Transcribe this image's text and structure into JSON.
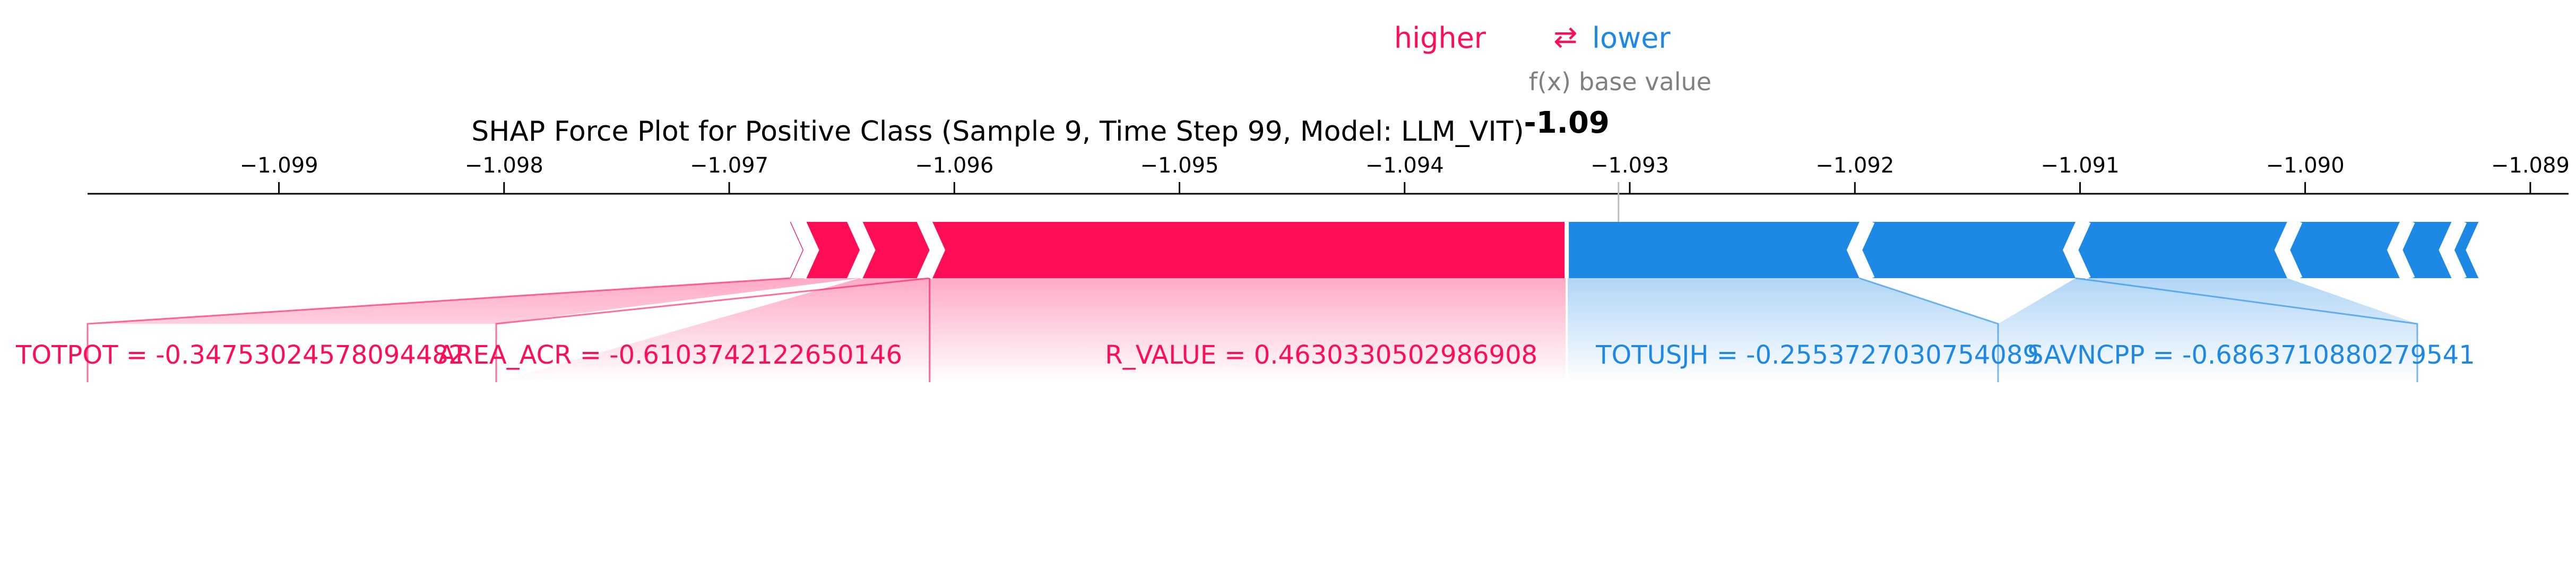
{
  "chart_data": {
    "type": "force",
    "title": "SHAP Force Plot for Positive Class (Sample 9, Time Step 99, Model: LLM_VIT)",
    "legend": {
      "higher": "higher",
      "arrow": "⇄",
      "lower": "lower"
    },
    "output_label": "f(x)",
    "base_label": "base value",
    "output_value_text": "-1.09",
    "output_value": -1.09328,
    "base_value": -1.09305,
    "xlim": [
      -1.09985,
      -1.08883
    ],
    "ticks": [
      -1.099,
      -1.098,
      -1.097,
      -1.096,
      -1.095,
      -1.094,
      -1.093,
      -1.092,
      -1.091,
      -1.09,
      -1.089
    ],
    "tick_labels": [
      "−1.099",
      "−1.098",
      "−1.097",
      "−1.096",
      "−1.095",
      "−1.094",
      "−1.093",
      "−1.092",
      "−1.091",
      "−1.090",
      "−1.089"
    ],
    "positive_segments": [
      {
        "start": -1.09673,
        "end": -1.09667
      },
      {
        "start": -1.09667,
        "end": -1.09642
      },
      {
        "start": -1.09642,
        "end": -1.09611,
        "label": "AREA_ACR = -0.6103742122650146"
      },
      {
        "start": -1.09611,
        "end": -1.09328,
        "label": "R_VALUE = 0.4630330502986908"
      }
    ],
    "negative_segments": [
      {
        "start": -1.09328,
        "end": -1.09198
      },
      {
        "start": -1.09198,
        "end": -1.09102,
        "label": "TOTUSJH = -0.2553727030754089"
      },
      {
        "start": -1.09102,
        "end": -1.09008,
        "label": "SAVNCPP = -0.6863710880279541"
      },
      {
        "start": -1.09008,
        "end": -1.08958
      },
      {
        "start": -1.08958,
        "end": -1.08935
      },
      {
        "start": -1.08935,
        "end": -1.08923
      }
    ],
    "extra_labels": [
      {
        "side": "positive",
        "label": "TOTPOT = -0.34753024578094482"
      }
    ],
    "colors": {
      "positive": "#ff0d57",
      "negative": "#1e88e5",
      "gray": "#808080"
    }
  }
}
